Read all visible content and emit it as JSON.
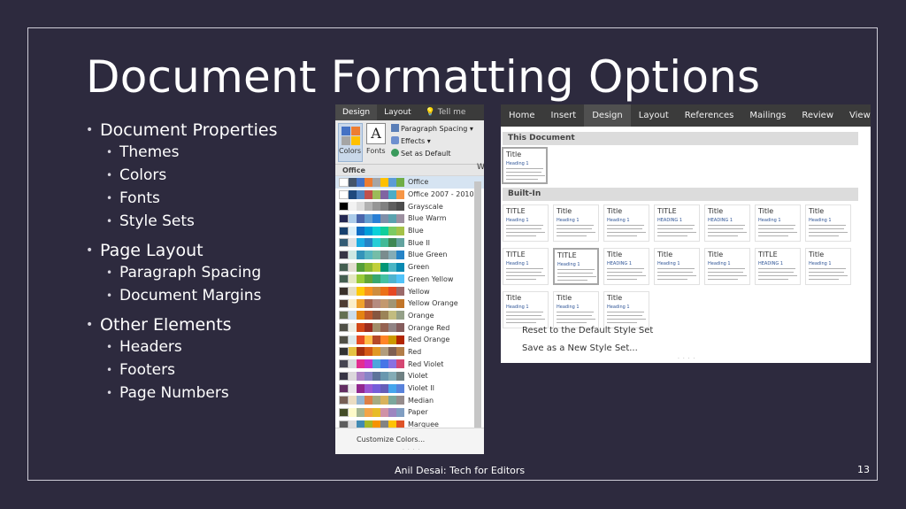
{
  "slide": {
    "title": "Document Formatting Options",
    "footer": "Anil Desai: Tech for Editors",
    "page_number": "13",
    "bullets": [
      {
        "label": "Document Properties",
        "children": [
          "Themes",
          "Colors",
          "Fonts",
          "Style Sets"
        ]
      },
      {
        "label": "Page Layout",
        "children": [
          "Paragraph Spacing",
          "Document Margins"
        ]
      },
      {
        "label": "Other Elements",
        "children": [
          "Headers",
          "Footers",
          "Page Numbers"
        ]
      }
    ]
  },
  "colors_dropdown": {
    "tabs": [
      "Design",
      "Layout",
      "Tell me"
    ],
    "ribbon": {
      "colors_label": "Colors",
      "fonts_label": "Fonts",
      "fonts_glyph": "A",
      "paragraph_spacing": "Paragraph Spacing",
      "effects": "Effects",
      "set_as_default": "Set as Default",
      "edge_letter": "W"
    },
    "group_header": "Office",
    "selected_index": 0,
    "palettes": [
      {
        "name": "Office",
        "colors": [
          "#ffffff",
          "#44546a",
          "#4472c4",
          "#ed7d31",
          "#a5a5a5",
          "#ffc000",
          "#5b9bd5",
          "#70ad47"
        ]
      },
      {
        "name": "Office 2007 - 2010",
        "colors": [
          "#ffffff",
          "#1f497d",
          "#4f81bd",
          "#c0504d",
          "#9bbb59",
          "#8064a2",
          "#4bacc6",
          "#f79646"
        ]
      },
      {
        "name": "Grayscale",
        "colors": [
          "#000000",
          "#f2f2f2",
          "#dddddd",
          "#b2b2b2",
          "#969696",
          "#808080",
          "#5f5f5f",
          "#4d4d4d"
        ]
      },
      {
        "name": "Blue Warm",
        "colors": [
          "#242852",
          "#acccea",
          "#4a66ac",
          "#629dd1",
          "#297fd5",
          "#7f8fa9",
          "#5aa2ae",
          "#9d90a0"
        ]
      },
      {
        "name": "Blue",
        "colors": [
          "#17406d",
          "#dbeff9",
          "#0f6fc6",
          "#009dd9",
          "#0bd0d9",
          "#10cf9b",
          "#7cca62",
          "#a5c249"
        ]
      },
      {
        "name": "Blue II",
        "colors": [
          "#335b74",
          "#dfe3e5",
          "#1cade4",
          "#2683c6",
          "#27ced7",
          "#42ba97",
          "#3e8853",
          "#62a39f"
        ]
      },
      {
        "name": "Blue Green",
        "colors": [
          "#373545",
          "#cee8e3",
          "#3494ba",
          "#58b6c0",
          "#75bda7",
          "#7a8c8e",
          "#84acb6",
          "#2683c6"
        ]
      },
      {
        "name": "Green",
        "colors": [
          "#455f51",
          "#e3ded1",
          "#549e39",
          "#8ab833",
          "#c0cf3a",
          "#029676",
          "#4ab5c4",
          "#0989b1"
        ]
      },
      {
        "name": "Green Yellow",
        "colors": [
          "#455f51",
          "#e5e8c2",
          "#99cb38",
          "#63a537",
          "#37a76f",
          "#44c1a3",
          "#4eb3cf",
          "#51c3f9"
        ]
      },
      {
        "name": "Yellow",
        "colors": [
          "#39302a",
          "#e5dec5",
          "#ffca08",
          "#f8931d",
          "#ce8d3e",
          "#ec7016",
          "#e64823",
          "#9c6a6a"
        ]
      },
      {
        "name": "Yellow Orange",
        "colors": [
          "#4e3b30",
          "#fbeec9",
          "#f0a22e",
          "#a5644e",
          "#b58b80",
          "#c3986d",
          "#a19574",
          "#c17529"
        ]
      },
      {
        "name": "Orange",
        "colors": [
          "#637052",
          "#ccddea",
          "#e48312",
          "#bd582c",
          "#865640",
          "#9b8357",
          "#c2bc80",
          "#94a088"
        ]
      },
      {
        "name": "Orange Red",
        "colors": [
          "#505046",
          "#eeece1",
          "#d34817",
          "#9b2d1f",
          "#a28e6a",
          "#956251",
          "#918485",
          "#855d5d"
        ]
      },
      {
        "name": "Red Orange",
        "colors": [
          "#505046",
          "#dde8e9",
          "#e84c22",
          "#ffbd47",
          "#b64926",
          "#ff8427",
          "#cc9900",
          "#b22600"
        ]
      },
      {
        "name": "Red",
        "colors": [
          "#323232",
          "#e5c243",
          "#a5300f",
          "#d55816",
          "#e19825",
          "#b19c7d",
          "#7f5f52",
          "#b27d49"
        ]
      },
      {
        "name": "Red Violet",
        "colors": [
          "#454551",
          "#d8d9dc",
          "#e32d91",
          "#c830cc",
          "#4ea6dc",
          "#4775e7",
          "#8971e1",
          "#d54773"
        ]
      },
      {
        "name": "Violet",
        "colors": [
          "#373545",
          "#dcd8dc",
          "#ad84c6",
          "#8784c7",
          "#5d739a",
          "#6997af",
          "#84acb6",
          "#6f8183"
        ]
      },
      {
        "name": "Violet II",
        "colors": [
          "#632e62",
          "#eae5eb",
          "#92278f",
          "#9b57d3",
          "#755dd9",
          "#665eb8",
          "#45a5ed",
          "#5982db"
        ]
      },
      {
        "name": "Median",
        "colors": [
          "#775f55",
          "#ebddc3",
          "#94b6d2",
          "#dd8047",
          "#a5ab81",
          "#d8b25c",
          "#7ba79d",
          "#968c8c"
        ]
      },
      {
        "name": "Paper",
        "colors": [
          "#444d26",
          "#fefac9",
          "#a5b592",
          "#f3a447",
          "#e7bc29",
          "#d092a7",
          "#9c85c0",
          "#809ec2"
        ]
      },
      {
        "name": "Marquee",
        "colors": [
          "#5e5e5e",
          "#ddddde",
          "#418ab3",
          "#a6b727",
          "#f69200",
          "#838383",
          "#fec306",
          "#df5327"
        ]
      }
    ],
    "customize": "Customize Colors..."
  },
  "style_sets": {
    "tabs": [
      "Home",
      "Insert",
      "Design",
      "Layout",
      "References",
      "Mailings",
      "Review",
      "View"
    ],
    "active_tab": "Design",
    "this_document": "This Document",
    "built_in": "Built-In",
    "current_thumb": {
      "title": "Title",
      "heading": "Heading 1"
    },
    "thumbs": [
      {
        "title": "TITLE",
        "heading": "Heading 1"
      },
      {
        "title": "Title",
        "heading": "Heading 1"
      },
      {
        "title": "Title",
        "heading": "Heading 1"
      },
      {
        "title": "TITLE",
        "heading": "HEADING 1"
      },
      {
        "title": "Title",
        "heading": "HEADING 1"
      },
      {
        "title": "Title",
        "heading": "Heading 1"
      },
      {
        "title": "Title",
        "heading": "Heading 1"
      },
      {
        "title": "TITLE",
        "heading": "Heading 1"
      },
      {
        "title": "TITLE",
        "heading": "Heading 1"
      },
      {
        "title": "Title",
        "heading": "HEADING 1"
      },
      {
        "title": "Title",
        "heading": "Heading 1"
      },
      {
        "title": "Title",
        "heading": "Heading 1"
      },
      {
        "title": "TITLE",
        "heading": "HEADING 1"
      },
      {
        "title": "Title",
        "heading": "Heading 1"
      },
      {
        "title": "Title",
        "heading": "Heading 1"
      },
      {
        "title": "Title",
        "heading": "Heading 1"
      },
      {
        "title": "Title",
        "heading": "Heading 1"
      }
    ],
    "reset": "Reset to the Default Style Set",
    "save_as": "Save as a New Style Set..."
  }
}
